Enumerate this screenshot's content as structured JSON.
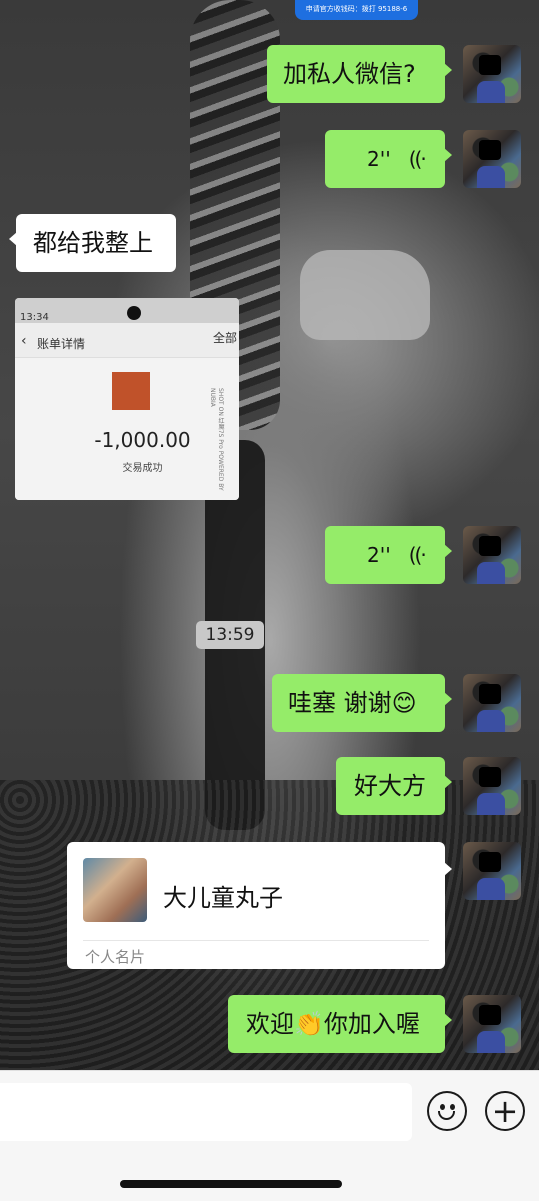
{
  "top_banner": {
    "text": "申请官方收钱码：拨打 95188-6"
  },
  "messages": [
    {
      "id": "m1",
      "side": "right",
      "text": "加私人微信?"
    },
    {
      "id": "m2",
      "side": "right",
      "type": "voice",
      "duration": "2''"
    },
    {
      "id": "m3",
      "side": "left",
      "text": "都给我整上"
    },
    {
      "id": "m4",
      "side": "left",
      "type": "image",
      "image": {
        "status_time": "13:34",
        "header_title": "账单详情",
        "header_right": "全部",
        "amount": "-1,000.00",
        "status": "交易成功",
        "watermark": "SHOT ON 红魔7S Pro  POWERED BY NUBIA"
      }
    },
    {
      "id": "m5",
      "side": "right",
      "type": "voice",
      "duration": "2''"
    },
    {
      "id": "ts",
      "type": "timestamp",
      "text": "13:59"
    },
    {
      "id": "m6",
      "side": "right",
      "text": "哇塞 谢谢😊"
    },
    {
      "id": "m7",
      "side": "right",
      "text": "好大方"
    },
    {
      "id": "m8",
      "side": "right",
      "type": "contact_card",
      "name": "大儿童丸子",
      "card_type": "个人名片"
    },
    {
      "id": "m9",
      "side": "right",
      "text": "欢迎👏你加入喔"
    }
  ],
  "voice_icon": "voice-wave-icon",
  "input_bar": {
    "placeholder": "",
    "emoji_icon": "smiley-icon",
    "plus_icon": "plus-circle-icon"
  },
  "colors": {
    "sent_bubble": "#95ec69",
    "received_bubble": "#ffffff",
    "input_bg": "#f6f6f6"
  }
}
